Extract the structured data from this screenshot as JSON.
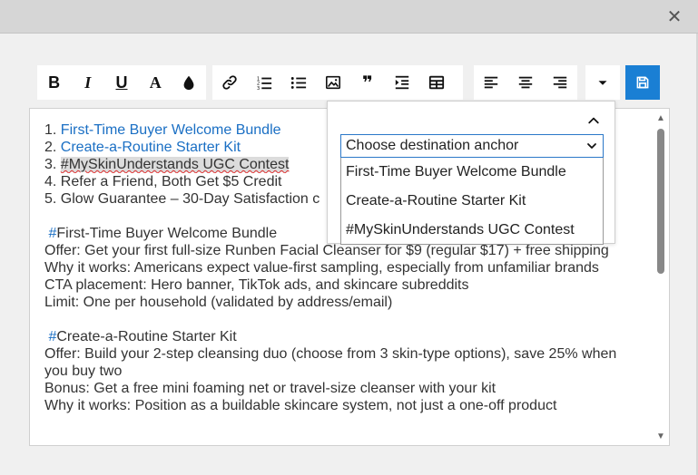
{
  "window": {
    "close_glyph": "✕"
  },
  "toolbar": {
    "italic_glyph": "I",
    "underline_glyph": "U",
    "font_color_glyph": "A",
    "bold_glyph": "B",
    "quote_glyph": "❞",
    "save_color": "#1a7fd4"
  },
  "editor": {
    "list": [
      {
        "num": "1. ",
        "text": "First-Time Buyer Welcome Bundle"
      },
      {
        "num": "2. ",
        "text": "Create-a-Routine Starter Kit"
      },
      {
        "num": "3. ",
        "text": "#MySkinUnderstands UGC Contest"
      },
      {
        "num": "4. ",
        "text": "Refer a Friend, Both Get $5 Credit"
      },
      {
        "num": "5. ",
        "text": "Glow Guarantee – 30-Day Satisfaction c"
      }
    ],
    "section1": {
      "hash": "#",
      "title": "First-Time Buyer Welcome Bundle",
      "offer": "Offer: Get your first full-size Runben Facial Cleanser for $9 (regular $17) + free shipping",
      "why": "Why it works: Americans expect value-first sampling, especially from unfamiliar brands",
      "cta": "CTA placement: Hero banner, TikTok ads, and skincare subreddits",
      "limit": "Limit: One per household (validated by address/email)"
    },
    "section2": {
      "hash": "#",
      "title": "Create-a-Routine Starter Kit",
      "offer": "Offer: Build your 2-step cleansing duo (choose from 3 skin-type options), save 25% when you buy two",
      "bonus": "Bonus: Get a free mini foaming net or travel-size cleanser with your kit",
      "why": "Why it works: Position as a buildable skincare system, not just a one-off product"
    }
  },
  "anchor_popup": {
    "select_value": "Choose destination anchor",
    "options": [
      "First-Time Buyer Welcome Bundle",
      "Create-a-Routine Starter Kit",
      "#MySkinUnderstands UGC Contest"
    ]
  },
  "colors": {
    "link": "#1a6fc4",
    "accent": "#1a7fd4",
    "highlight": "#dcdcdc"
  }
}
